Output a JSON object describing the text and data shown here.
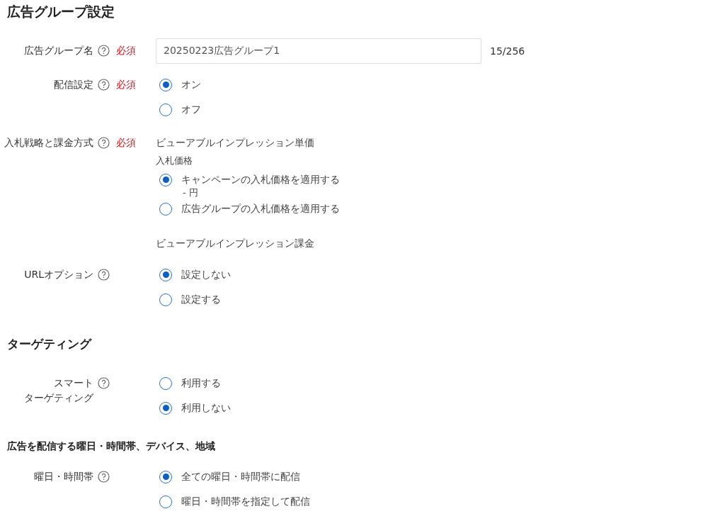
{
  "blocks": [
    {
      "kind": "title",
      "text": "広告グループ設定"
    },
    {
      "kind": "field",
      "label": "広告グループ名",
      "help": true,
      "required": "必須",
      "content": [
        {
          "kind": "input",
          "value": "20250223広告グループ1",
          "counter": "15/256"
        }
      ]
    },
    {
      "kind": "field",
      "label": "配信設定",
      "help": true,
      "required": "必須",
      "content": [
        {
          "kind": "radio",
          "label": "オン",
          "selected": true
        },
        {
          "kind": "radio",
          "label": "オフ",
          "selected": false
        }
      ]
    },
    {
      "kind": "field",
      "label": "入札戦略と課金方式",
      "help": true,
      "required": "必須",
      "content": [
        {
          "kind": "text",
          "text": "ビューアブルインプレッション単価"
        },
        {
          "kind": "caption",
          "text": "入札価格"
        },
        {
          "kind": "radio",
          "label": "キャンペーンの入札価格を適用する",
          "selected": true
        },
        {
          "kind": "note",
          "text": "- 円"
        },
        {
          "kind": "radio",
          "label": "広告グループの入札価格を適用する",
          "selected": false
        },
        {
          "kind": "text",
          "text": "ビューアブルインプレッション課金"
        }
      ]
    },
    {
      "kind": "field",
      "label": "URLオプション",
      "help": true,
      "content": [
        {
          "kind": "radio",
          "label": "設定しない",
          "selected": true
        },
        {
          "kind": "radio",
          "label": "設定する",
          "selected": false
        }
      ]
    },
    {
      "kind": "section",
      "text": "ターゲティング"
    },
    {
      "kind": "field",
      "label_lines": [
        "スマート",
        "ターゲティング"
      ],
      "help": true,
      "content": [
        {
          "kind": "radio",
          "label": "利用する",
          "selected": false
        },
        {
          "kind": "radio",
          "label": "利用しない",
          "selected": true
        }
      ]
    },
    {
      "kind": "subsection",
      "text": "広告を配信する曜日・時間帯、デバイス、地域"
    },
    {
      "kind": "field",
      "label": "曜日・時間帯",
      "help": true,
      "content": [
        {
          "kind": "radio",
          "label": "全ての曜日・時間帯に配信",
          "selected": true
        },
        {
          "kind": "radio",
          "label": "曜日・時間帯を指定して配信",
          "selected": false
        }
      ]
    }
  ]
}
